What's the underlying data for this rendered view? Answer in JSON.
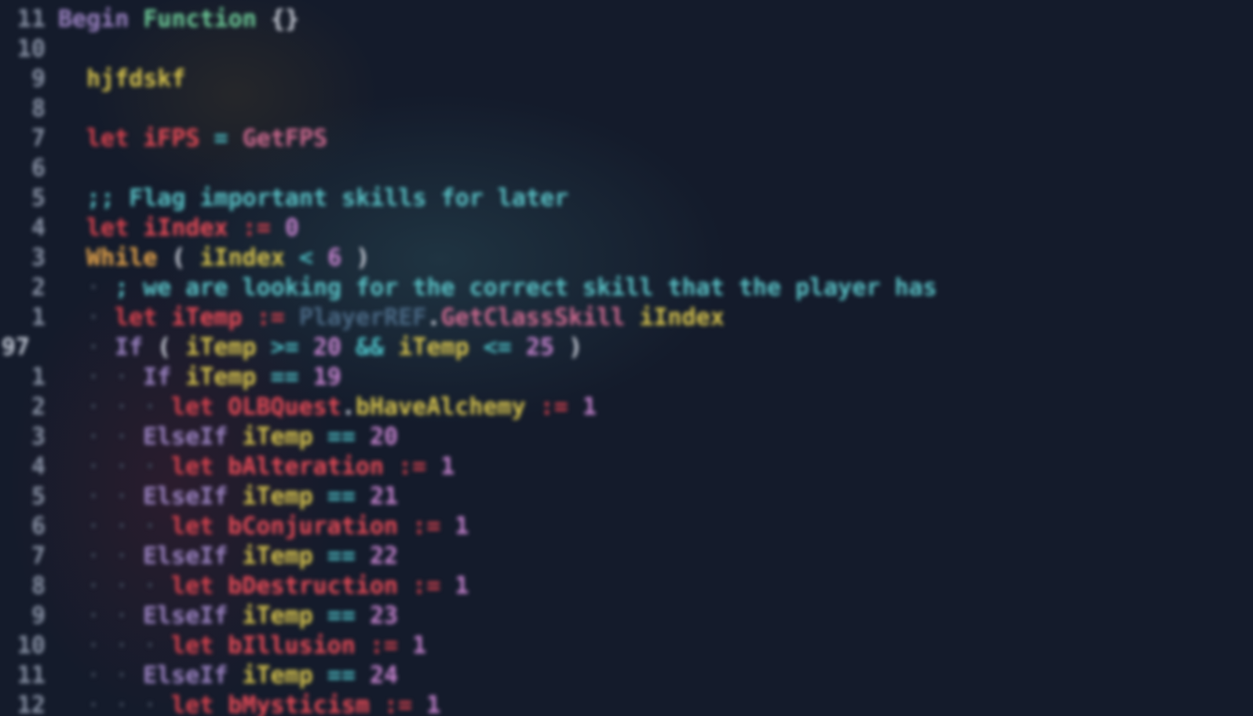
{
  "editor": {
    "theme_colors": {
      "background": "#141b2b",
      "keyword": "#9d84c4",
      "let": "#d9424e",
      "variable": "#e84a56",
      "member": "#d8c44c",
      "number": "#c884d0",
      "comment": "#59c2c6",
      "operator": "#4ec3c9"
    },
    "lines": [
      {
        "num": "11",
        "indent": 0,
        "tokens": [
          {
            "t": "Begin",
            "c": "kw-purple"
          },
          {
            "t": " ",
            "c": "plain"
          },
          {
            "t": "Function",
            "c": "kw-green"
          },
          {
            "t": " {}",
            "c": "plain"
          }
        ]
      },
      {
        "num": "10",
        "indent": 0,
        "tokens": []
      },
      {
        "num": "9",
        "indent": 1,
        "tokens": [
          {
            "t": "hjfdskf",
            "c": "var-yel"
          }
        ]
      },
      {
        "num": "8",
        "indent": 0,
        "tokens": []
      },
      {
        "num": "7",
        "indent": 1,
        "tokens": [
          {
            "t": "let",
            "c": "kw-let"
          },
          {
            "t": " ",
            "c": "plain"
          },
          {
            "t": "iFPS",
            "c": "var-red"
          },
          {
            "t": " = ",
            "c": "op"
          },
          {
            "t": "GetFPS",
            "c": "fn-pink"
          }
        ]
      },
      {
        "num": "6",
        "indent": 0,
        "tokens": []
      },
      {
        "num": "5",
        "indent": 1,
        "tokens": [
          {
            "t": ";; Flag important skills for later",
            "c": "cmt"
          }
        ]
      },
      {
        "num": "4",
        "indent": 1,
        "tokens": [
          {
            "t": "let",
            "c": "kw-let"
          },
          {
            "t": " ",
            "c": "plain"
          },
          {
            "t": "iIndex",
            "c": "var-red"
          },
          {
            "t": " := ",
            "c": "kw-let"
          },
          {
            "t": "0",
            "c": "num"
          }
        ]
      },
      {
        "num": "3",
        "indent": 1,
        "tokens": [
          {
            "t": "While",
            "c": "kw-while"
          },
          {
            "t": " ( ",
            "c": "plain"
          },
          {
            "t": "iIndex",
            "c": "var-yel"
          },
          {
            "t": " < ",
            "c": "op"
          },
          {
            "t": "6",
            "c": "num"
          },
          {
            "t": " )",
            "c": "plain"
          }
        ]
      },
      {
        "num": "2",
        "indent": 2,
        "tokens": [
          {
            "t": "; we are looking for the correct skill that the player has",
            "c": "cmt"
          }
        ]
      },
      {
        "num": "1",
        "indent": 2,
        "tokens": [
          {
            "t": "let",
            "c": "kw-let"
          },
          {
            "t": " ",
            "c": "plain"
          },
          {
            "t": "iTemp",
            "c": "var-red"
          },
          {
            "t": " := ",
            "c": "kw-let"
          },
          {
            "t": "PlayerREF",
            "c": "dim"
          },
          {
            "t": ".",
            "c": "plain"
          },
          {
            "t": "GetClassSkill",
            "c": "fn-pink"
          },
          {
            "t": " ",
            "c": "plain"
          },
          {
            "t": "iIndex",
            "c": "var-yel"
          }
        ]
      },
      {
        "num": "97",
        "indent": 2,
        "current": true,
        "tokens": [
          {
            "t": "If",
            "c": "kw-purple"
          },
          {
            "t": " ( ",
            "c": "plain"
          },
          {
            "t": "iTemp",
            "c": "var-yel"
          },
          {
            "t": " >= ",
            "c": "op"
          },
          {
            "t": "20",
            "c": "num"
          },
          {
            "t": " && ",
            "c": "op"
          },
          {
            "t": "iTemp",
            "c": "var-yel"
          },
          {
            "t": " <= ",
            "c": "op"
          },
          {
            "t": "25",
            "c": "num"
          },
          {
            "t": " )",
            "c": "plain"
          }
        ]
      },
      {
        "num": "1",
        "indent": 3,
        "tokens": [
          {
            "t": "If",
            "c": "kw-purple"
          },
          {
            "t": " ",
            "c": "plain"
          },
          {
            "t": "iTemp",
            "c": "var-yel"
          },
          {
            "t": " == ",
            "c": "op"
          },
          {
            "t": "19",
            "c": "num"
          }
        ]
      },
      {
        "num": "2",
        "indent": 4,
        "tokens": [
          {
            "t": "let",
            "c": "kw-let"
          },
          {
            "t": " ",
            "c": "plain"
          },
          {
            "t": "OLBQuest",
            "c": "var-red"
          },
          {
            "t": ".",
            "c": "plain"
          },
          {
            "t": "bHaveAlchemy",
            "c": "var-yel"
          },
          {
            "t": " := ",
            "c": "kw-let"
          },
          {
            "t": "1",
            "c": "num"
          }
        ]
      },
      {
        "num": "3",
        "indent": 3,
        "tokens": [
          {
            "t": "ElseIf",
            "c": "kw-purple"
          },
          {
            "t": " ",
            "c": "plain"
          },
          {
            "t": "iTemp",
            "c": "var-yel"
          },
          {
            "t": " == ",
            "c": "op"
          },
          {
            "t": "20",
            "c": "num"
          }
        ]
      },
      {
        "num": "4",
        "indent": 4,
        "tokens": [
          {
            "t": "let",
            "c": "kw-let"
          },
          {
            "t": " ",
            "c": "plain"
          },
          {
            "t": "bAlteration",
            "c": "var-red"
          },
          {
            "t": " := ",
            "c": "kw-let"
          },
          {
            "t": "1",
            "c": "num"
          }
        ]
      },
      {
        "num": "5",
        "indent": 3,
        "tokens": [
          {
            "t": "ElseIf",
            "c": "kw-purple"
          },
          {
            "t": " ",
            "c": "plain"
          },
          {
            "t": "iTemp",
            "c": "var-yel"
          },
          {
            "t": " == ",
            "c": "op"
          },
          {
            "t": "21",
            "c": "num"
          }
        ]
      },
      {
        "num": "6",
        "indent": 4,
        "tokens": [
          {
            "t": "let",
            "c": "kw-let"
          },
          {
            "t": " ",
            "c": "plain"
          },
          {
            "t": "bConjuration",
            "c": "var-red"
          },
          {
            "t": " := ",
            "c": "kw-let"
          },
          {
            "t": "1",
            "c": "num"
          }
        ]
      },
      {
        "num": "7",
        "indent": 3,
        "tokens": [
          {
            "t": "ElseIf",
            "c": "kw-purple"
          },
          {
            "t": " ",
            "c": "plain"
          },
          {
            "t": "iTemp",
            "c": "var-yel"
          },
          {
            "t": " == ",
            "c": "op"
          },
          {
            "t": "22",
            "c": "num"
          }
        ]
      },
      {
        "num": "8",
        "indent": 4,
        "tokens": [
          {
            "t": "let",
            "c": "kw-let"
          },
          {
            "t": " ",
            "c": "plain"
          },
          {
            "t": "bDestruction",
            "c": "var-red"
          },
          {
            "t": " := ",
            "c": "kw-let"
          },
          {
            "t": "1",
            "c": "num"
          }
        ]
      },
      {
        "num": "9",
        "indent": 3,
        "tokens": [
          {
            "t": "ElseIf",
            "c": "kw-purple"
          },
          {
            "t": " ",
            "c": "plain"
          },
          {
            "t": "iTemp",
            "c": "var-yel"
          },
          {
            "t": " == ",
            "c": "op"
          },
          {
            "t": "23",
            "c": "num"
          }
        ]
      },
      {
        "num": "10",
        "indent": 4,
        "tokens": [
          {
            "t": "let",
            "c": "kw-let"
          },
          {
            "t": " ",
            "c": "plain"
          },
          {
            "t": "bIllusion",
            "c": "var-red"
          },
          {
            "t": " := ",
            "c": "kw-let"
          },
          {
            "t": "1",
            "c": "num"
          }
        ]
      },
      {
        "num": "11",
        "indent": 3,
        "tokens": [
          {
            "t": "ElseIf",
            "c": "kw-purple"
          },
          {
            "t": " ",
            "c": "plain"
          },
          {
            "t": "iTemp",
            "c": "var-yel"
          },
          {
            "t": " == ",
            "c": "op"
          },
          {
            "t": "24",
            "c": "num"
          }
        ]
      },
      {
        "num": "12",
        "indent": 4,
        "tokens": [
          {
            "t": "let",
            "c": "kw-let"
          },
          {
            "t": " ",
            "c": "plain"
          },
          {
            "t": "bMysticism",
            "c": "var-red"
          },
          {
            "t": " := ",
            "c": "kw-let"
          },
          {
            "t": "1",
            "c": "num"
          }
        ]
      }
    ]
  }
}
